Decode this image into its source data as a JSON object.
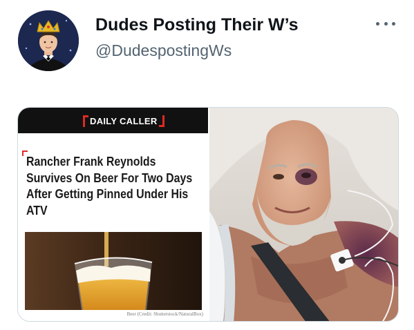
{
  "tweet": {
    "display_name": "Dudes Posting Their W’s",
    "handle": "@DudespostingWs",
    "avatar_icon": "avatar-crowned-man-icon",
    "more_icon": "more-options-icon"
  },
  "media": {
    "article_card": {
      "publisher": "DAILY CALLER",
      "headline": "Rancher Frank Reynolds Survives On Beer For Two Days After Getting Pinned Under His ATV",
      "photo_credit": "Beer (Credit: Shutterstock/NaturalBox)",
      "accent_color": "#e02a24"
    },
    "hospital_photo": {
      "description_icon": "hospital-patient-photo"
    }
  }
}
